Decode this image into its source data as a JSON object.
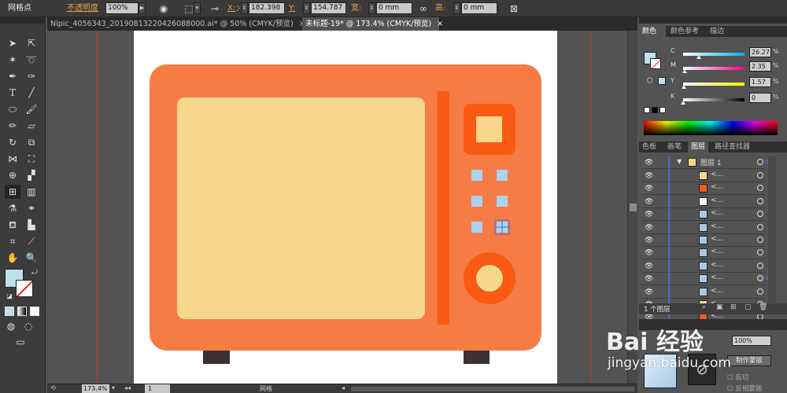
{
  "control_bar": {
    "tool_label": "网格点",
    "opacity_label": "不透明度",
    "opacity_value": "100%",
    "x_label": "X:",
    "x_value": "182.398 :",
    "y_label": "Y:",
    "y_value": "154.787 :",
    "width_label": "宽:",
    "width_value": "0 mm",
    "height_label": "高:",
    "height_value": "0 mm"
  },
  "document_tabs": [
    {
      "label": "Nipic_4056343_20190813220426088000.ai* @ 50% (CMYK/预览)",
      "close": "×"
    },
    {
      "label": "未标题-19* @ 173.4% (CMYK/预览)",
      "close": "×"
    }
  ],
  "color_panel": {
    "tabs": [
      "颜色",
      "颜色参考",
      "描边"
    ],
    "sliders": [
      {
        "label": "C",
        "value": "26.27",
        "pct": 0.2627,
        "unit": "%"
      },
      {
        "label": "M",
        "value": "2.35",
        "pct": 0.0235,
        "unit": "%"
      },
      {
        "label": "Y",
        "value": "1.57",
        "pct": 0.0157,
        "unit": "%"
      },
      {
        "label": "K",
        "value": "0",
        "pct": 0,
        "unit": "%"
      }
    ],
    "fill_color": "#bfe0ed"
  },
  "layers_panel": {
    "tabs": [
      "色板",
      "画笔",
      "图层",
      "路径查找器"
    ],
    "layer_name": "图层 1",
    "sublayer_label": "<...",
    "sublayer_thumbs": [
      "#f7d78b",
      "#f55a14",
      "#ffffff",
      "#a9c8e8",
      "#a9c8e8",
      "#a9c8e8",
      "#a9c8e8",
      "#a9c8e8",
      "#a9c8e8",
      "#a9c8e8",
      "#f7d78b",
      "#f55a14"
    ],
    "status": "1 个图层"
  },
  "transparency_panel": {
    "opacity_value": "100%",
    "make_mask_button": "制作蒙版",
    "clip_label": "剪切",
    "invert_mask_label": "反相蒙版"
  },
  "status_bar": {
    "zoom_value": "173.4%",
    "page_value": "1",
    "tool_name": "网格"
  },
  "watermark": {
    "brand": "Bai 经验",
    "url": "jingyan.baidu.com"
  },
  "colors": {
    "microwave_body": "#f77b45",
    "window": "#f7d78b",
    "divider": "#fa5a14",
    "panel_knob": "#fa5a14",
    "buttons": "#a9d3ef",
    "feet": "#3b3131"
  }
}
